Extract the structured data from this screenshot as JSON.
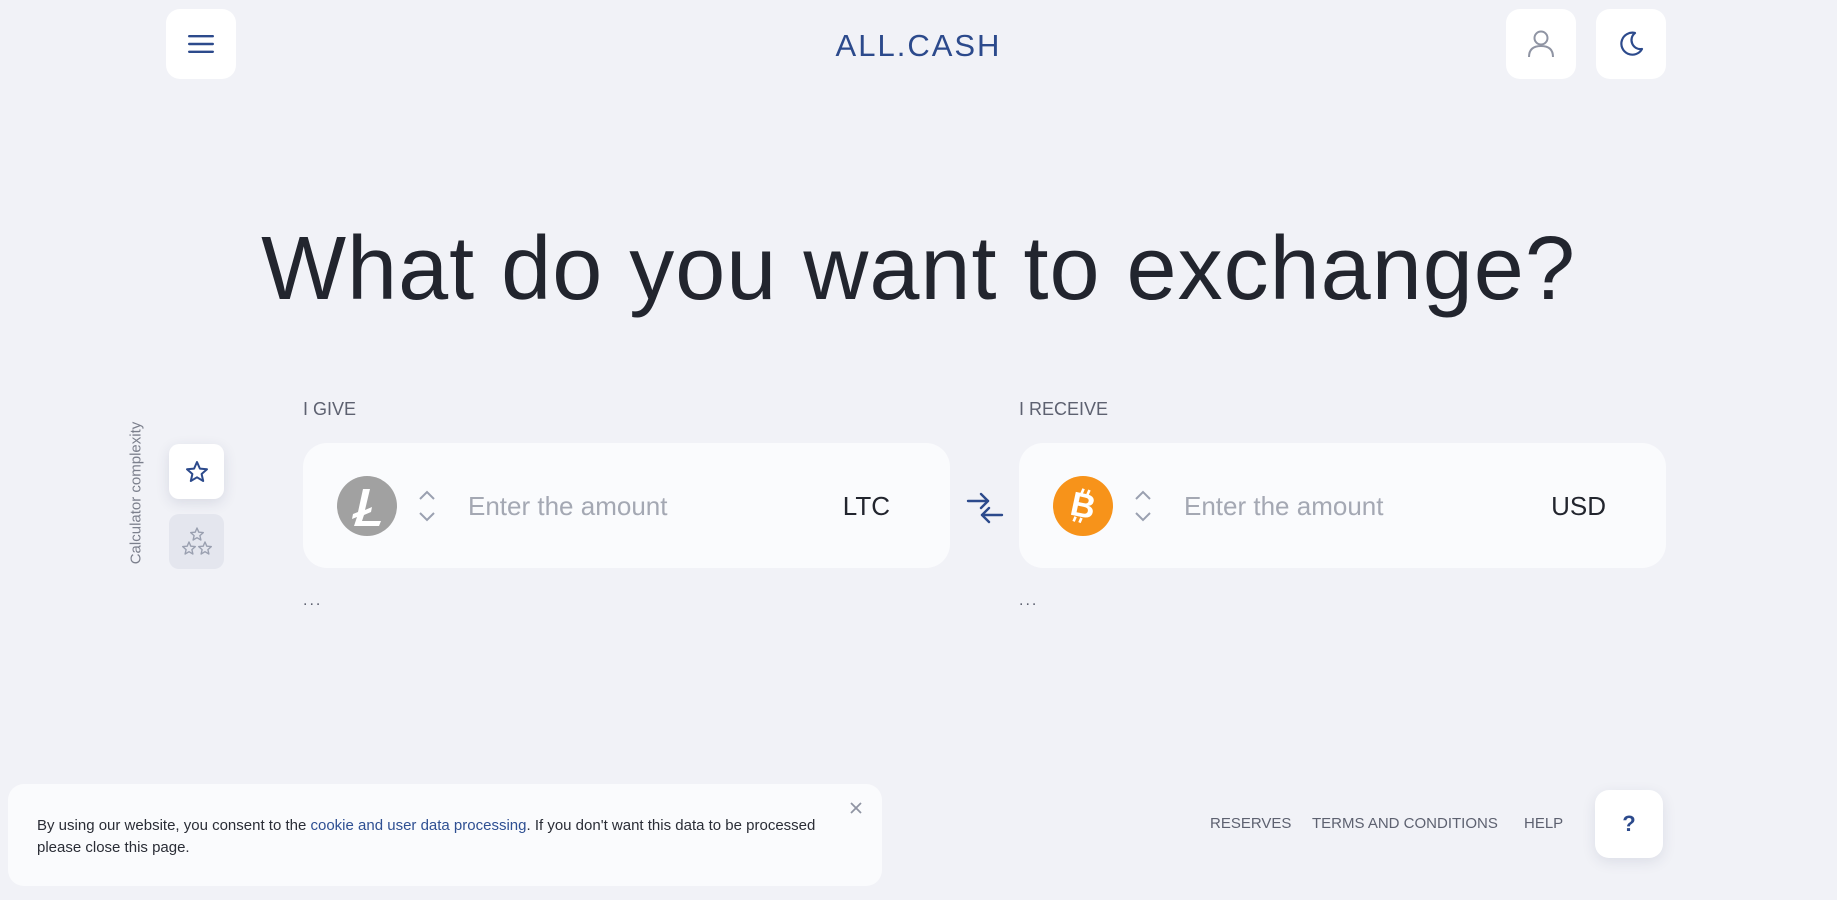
{
  "header": {
    "logo": "ALL.CASH",
    "menu_icon": "hamburger-menu-icon",
    "account_icon": "user-icon",
    "theme_icon": "moon-icon"
  },
  "main": {
    "headline": "What do you want to exchange?",
    "give": {
      "label": "I GIVE",
      "currency_icon": "litecoin-icon",
      "amount_placeholder": "Enter the amount",
      "amount_value": "",
      "currency_code": "LTC",
      "info": "..."
    },
    "receive": {
      "label": "I RECEIVE",
      "currency_icon": "bitcoin-icon",
      "amount_placeholder": "Enter the amount",
      "amount_value": "",
      "currency_code": "USD",
      "info": "..."
    },
    "swap_icon": "swap-arrows-icon"
  },
  "calculator": {
    "label": "Calculator complexity",
    "simple_icon": "star-icon",
    "advanced_icon": "three-stars-icon"
  },
  "cookie_banner": {
    "text_before": "By using our website, you consent to the ",
    "link_text": "cookie and user data processing",
    "text_after": ". If you don't want this data to be processed please close this page.",
    "close_icon": "close-icon"
  },
  "footer": {
    "reserves": "RESERVES",
    "terms": "TERMS AND CONDITIONS",
    "help": "HELP",
    "help_button": "?"
  },
  "colors": {
    "background": "#f1f2f7",
    "accent": "#2c4a8c",
    "litecoin": "#a1a1a1",
    "bitcoin": "#f7931a"
  }
}
